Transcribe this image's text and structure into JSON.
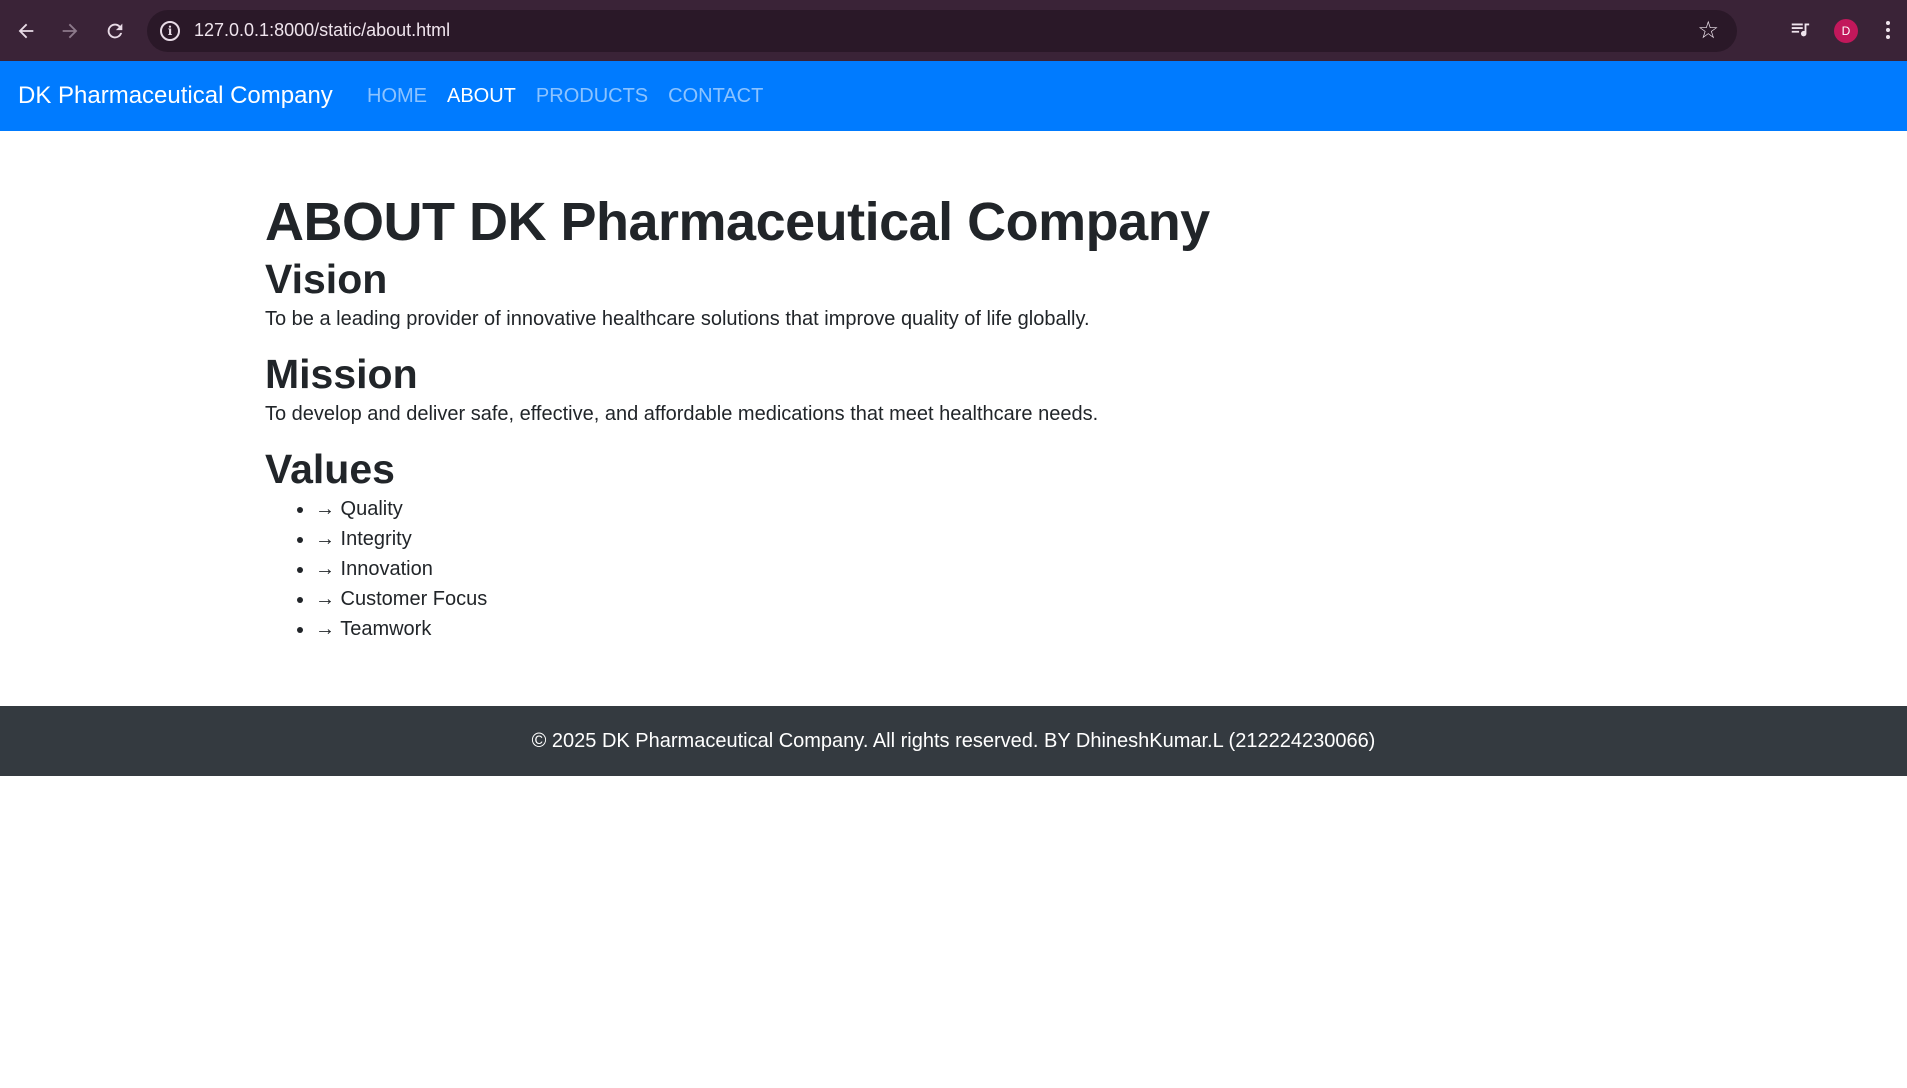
{
  "browser": {
    "url": "127.0.0.1:8000/static/about.html",
    "avatar_letter": "D",
    "icons": [
      "back-arrow-icon",
      "forward-arrow-icon",
      "reload-icon",
      "info-icon",
      "bookmark-star-icon",
      "reading-list-icon",
      "menu-kebab-icon"
    ]
  },
  "navbar": {
    "brand": "DK Pharmaceutical Company",
    "links": [
      {
        "label": "HOME",
        "active": false
      },
      {
        "label": "ABOUT",
        "active": true
      },
      {
        "label": "PRODUCTS",
        "active": false
      },
      {
        "label": "CONTACT",
        "active": false
      }
    ],
    "color": "#007bff"
  },
  "main": {
    "title": "ABOUT DK Pharmaceutical Company",
    "vision": {
      "heading": "Vision",
      "text": "To be a leading provider of innovative healthcare solutions that improve quality of life globally."
    },
    "mission": {
      "heading": "Mission",
      "text": "To develop and deliver safe, effective, and affordable medications that meet healthcare needs."
    },
    "values": {
      "heading": "Values",
      "items": [
        "→ Quality",
        "→ Integrity",
        "→ Innovation",
        "→ Customer Focus",
        "→ Teamwork"
      ]
    }
  },
  "footer": {
    "text": "© 2025 DK Pharmaceutical Company. All rights reserved. BY DhineshKumar.L (212224230066)",
    "color": "#343a40"
  }
}
